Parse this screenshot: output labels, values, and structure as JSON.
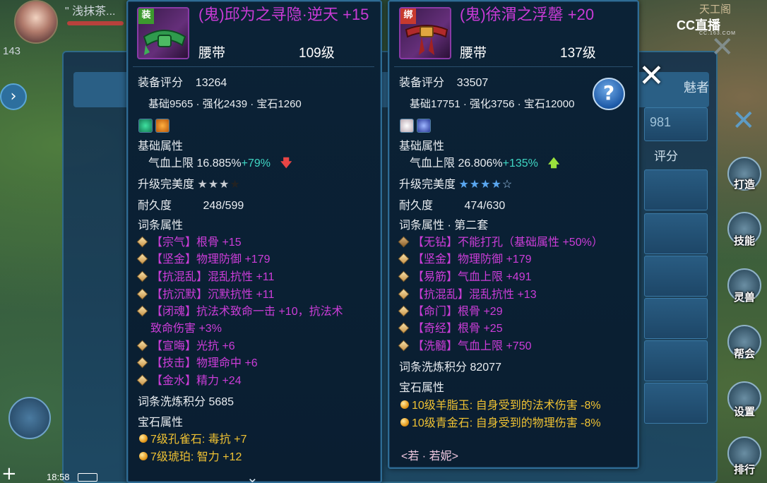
{
  "background": {
    "hud_name": "\" 浅抹茶...",
    "hud_level": "143",
    "hud_time": "18:58",
    "cc_logo": "CC直播",
    "cc_logo_sub": "CC.163.COM",
    "top_right_text": "天工阁",
    "window_tab_label": "魅者",
    "window_value": "981",
    "window_col_label": "评分",
    "side_buttons": [
      "打造",
      "技能",
      "灵兽",
      "帮会",
      "设置",
      "排行"
    ]
  },
  "left_item": {
    "icon_tag": "装",
    "name": "(鬼)邱为之寻隐·逆天 +15",
    "type": "腰带",
    "level": "109级",
    "score_label": "装备评分",
    "score_value": "13264",
    "score_breakdown": "基础9565 · 强化2439 · 宝石1260",
    "base_attr_label": "基础属性",
    "base_attr_text": "气血上限 16.885%",
    "base_attr_delta": "+79%",
    "perfection_label": "升级完美度",
    "perfection_stars": "★★★★",
    "perfection_filled": 3,
    "durability_label": "耐久度",
    "durability_value": "248/599",
    "affix_label": "词条属性",
    "affixes": [
      {
        "tag": "【宗气】",
        "text": "根骨 +15"
      },
      {
        "tag": "【坚金】",
        "text": "物理防御 +179"
      },
      {
        "tag": "【抗混乱】",
        "text": "混乱抗性 +11"
      },
      {
        "tag": "【抗沉默】",
        "text": "沉默抗性 +11"
      },
      {
        "tag": "【闭魂】",
        "text": "抗法术致命一击 +10，抗法术"
      },
      {
        "tag": "",
        "text": "致命伤害 +3%"
      },
      {
        "tag": "【宣晦】",
        "text": "光抗 +6"
      },
      {
        "tag": "【技击】",
        "text": "物理命中 +6"
      },
      {
        "tag": "【金水】",
        "text": "精力 +24"
      }
    ],
    "refine_label": "词条洗炼积分",
    "refine_value": "5685",
    "gem_label": "宝石属性",
    "gems": [
      "7级孔雀石: 毒抗 +7",
      "7级琥珀: 智力 +12"
    ]
  },
  "right_item": {
    "icon_tag": "绑",
    "name": "(鬼)徐渭之浮罄 +20",
    "type": "腰带",
    "level": "137级",
    "score_label": "装备评分",
    "score_value": "33507",
    "score_breakdown": "基础17751 · 强化3756 · 宝石12000",
    "base_attr_label": "基础属性",
    "base_attr_text": "气血上限 26.806%",
    "base_attr_delta": "+135%",
    "perfection_label": "升级完美度",
    "perfection_stars": "★★★★☆",
    "perfection_filled": 4,
    "durability_label": "耐久度",
    "durability_value": "474/630",
    "affix_label": "词条属性 · 第二套",
    "affixes": [
      {
        "tag": "【无钻】",
        "text": "不能打孔（基础属性 +50%）"
      },
      {
        "tag": "【坚金】",
        "text": "物理防御 +179"
      },
      {
        "tag": "【易筋】",
        "text": "气血上限 +491"
      },
      {
        "tag": "【抗混乱】",
        "text": "混乱抗性 +13"
      },
      {
        "tag": "【命门】",
        "text": "根骨 +29"
      },
      {
        "tag": "【奇经】",
        "text": "根骨 +25"
      },
      {
        "tag": "【洗髓】",
        "text": "气血上限 +750"
      }
    ],
    "refine_label": "词条洗炼积分",
    "refine_value": "82077",
    "gem_label": "宝石属性",
    "gems": [
      "10级羊脂玉: 自身受到的法术伤害 -8%",
      "10级青金石: 自身受到的物理伤害 -8%"
    ],
    "owner": "<若 · 若妮>"
  },
  "colors": {
    "item_name": "#cc3dd9",
    "affix": "#cc3dd9",
    "gem_text": "#f0c233",
    "delta": "#3fd6c3",
    "arrow_down": "#e84545",
    "arrow_up": "#9be23d",
    "star": "#5aa7f0"
  },
  "icons": {
    "help": "question-icon",
    "close": "close-icon",
    "more": "chevron-down-icon"
  }
}
